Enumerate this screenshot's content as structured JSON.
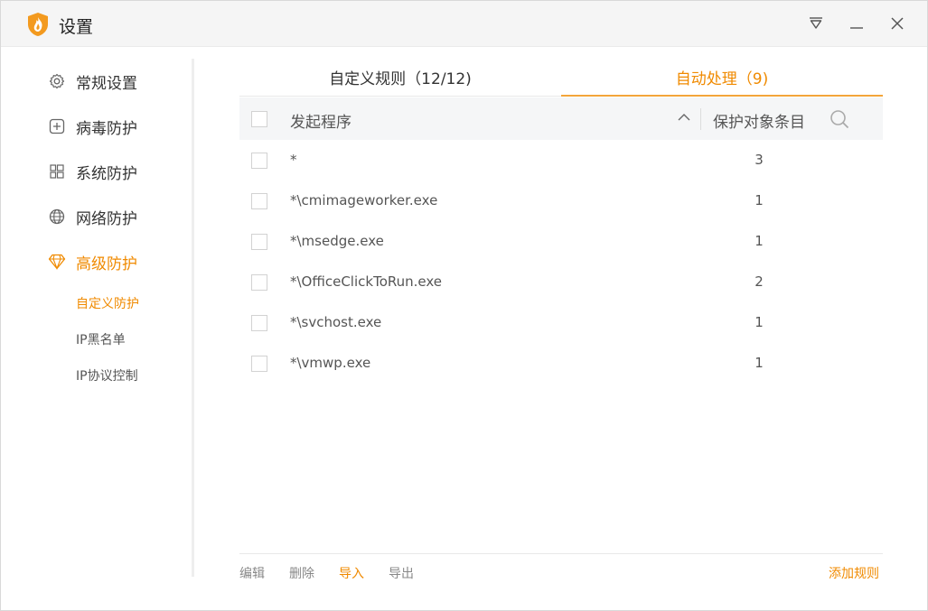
{
  "window": {
    "title": "设置"
  },
  "titlebar": {
    "menu_icon": "menu-triangle-icon",
    "minimize_icon": "minimize-icon",
    "close_icon": "close-icon"
  },
  "sidebar": {
    "items": [
      {
        "label": "常规设置",
        "icon": "gear-icon"
      },
      {
        "label": "病毒防护",
        "icon": "plus-square-icon"
      },
      {
        "label": "系统防护",
        "icon": "windows-icon"
      },
      {
        "label": "网络防护",
        "icon": "globe-icon"
      },
      {
        "label": "高级防护",
        "icon": "diamond-icon",
        "active": true
      }
    ],
    "sub_items": [
      {
        "label": "自定义防护",
        "active": true
      },
      {
        "label": "IP黑名单"
      },
      {
        "label": "IP协议控制"
      }
    ]
  },
  "tabs": [
    {
      "label": "自定义规则（12/12)"
    },
    {
      "label": "自动处理（9)",
      "active": true
    }
  ],
  "table": {
    "columns": [
      {
        "label": "发起程序"
      },
      {
        "label": "保护对象条目"
      }
    ],
    "rows": [
      {
        "name": "*",
        "count": "3"
      },
      {
        "name": "*\\cmimageworker.exe",
        "count": "1"
      },
      {
        "name": "*\\msedge.exe",
        "count": "1"
      },
      {
        "name": "*\\OfficeClickToRun.exe",
        "count": "2"
      },
      {
        "name": "*\\svchost.exe",
        "count": "1"
      },
      {
        "name": "*\\vmwp.exe",
        "count": "1"
      }
    ]
  },
  "footer": {
    "edit": "编辑",
    "delete": "删除",
    "import": "导入",
    "export": "导出",
    "add_rule": "添加规则"
  },
  "colors": {
    "accent": "#f08a00",
    "underline": "#f3a53a"
  }
}
